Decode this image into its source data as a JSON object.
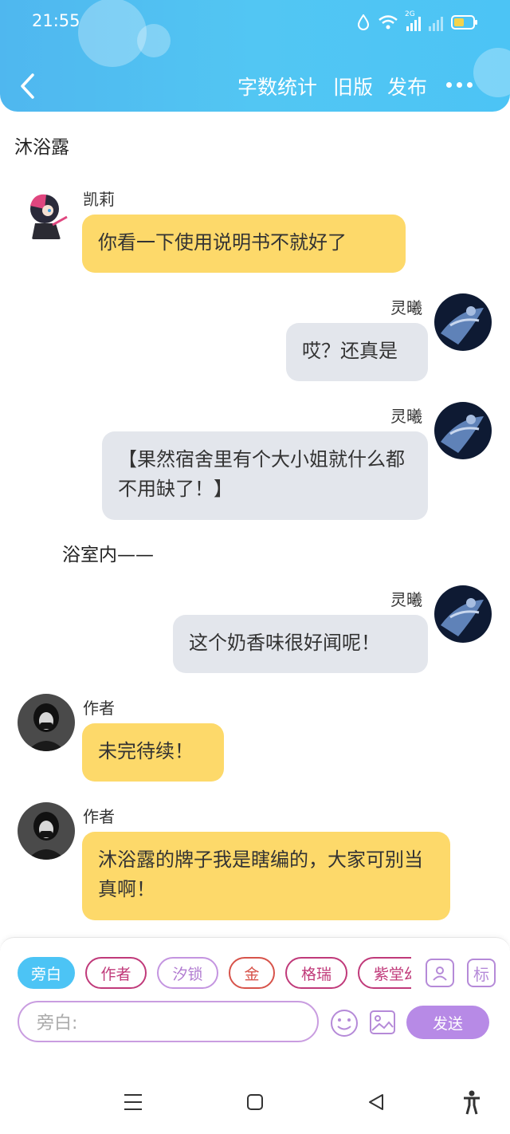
{
  "status": {
    "time": "21:55",
    "network": "2G"
  },
  "header": {
    "back_icon": "chevron-left-icon",
    "word_count": "字数统计",
    "old_version": "旧版",
    "publish": "发布",
    "more_icon": "more-dots-icon"
  },
  "scene_title": "沐浴露",
  "narration": "浴室内——",
  "messages": [
    {
      "side": "left",
      "name": "凯莉",
      "text": "你看一下使用说明书不就好了"
    },
    {
      "side": "right",
      "name": "灵曦",
      "text": "哎？还真是"
    },
    {
      "side": "right",
      "name": "灵曦",
      "text": "【果然宿舍里有个大小姐就什么都不用缺了！】"
    },
    {
      "side": "right",
      "name": "灵曦",
      "text": "这个奶香味很好闻呢！"
    },
    {
      "side": "left",
      "name": "作者",
      "text": "未完待续！"
    },
    {
      "side": "left",
      "name": "作者",
      "text": "沐浴露的牌子我是瞎编的，大家可别当真啊！"
    }
  ],
  "composer": {
    "roles": [
      "旁白",
      "作者",
      "汐锁",
      "金",
      "格瑞",
      "紫堂幻"
    ],
    "selected_role": "旁白",
    "input_placeholder": "旁白:",
    "send_label": "发送",
    "tag_label": "标",
    "emoji_icon": "smile-icon",
    "image_icon": "image-icon",
    "role_icon": "person-icon"
  },
  "colors": {
    "header": "#4fb7ef",
    "left_bubble": "#fdd96a",
    "right_bubble": "#e3e6ec",
    "accent_purple": "#b78ae6",
    "chip_pink": "#c03a7a"
  }
}
